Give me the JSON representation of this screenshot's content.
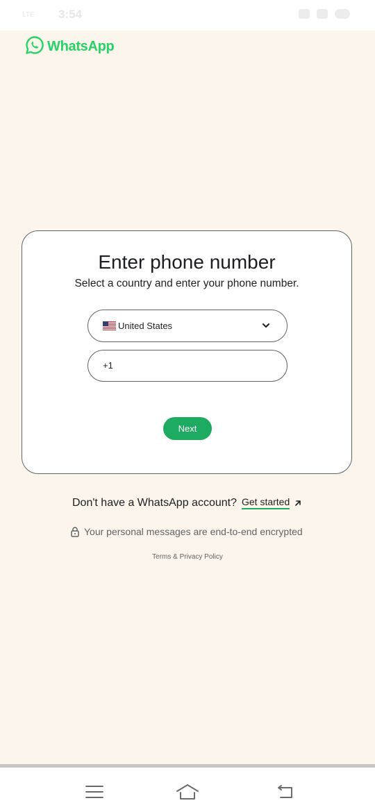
{
  "status_bar": {
    "time": "3:54",
    "signal": "LTE"
  },
  "brand": {
    "name": "WhatsApp",
    "color": "#25d366",
    "icon": "whatsapp-logo-icon"
  },
  "card": {
    "title": "Enter phone number",
    "subtitle": "Select a country and enter your phone number.",
    "country_select": {
      "selected": "United States",
      "flag": "us-flag-icon"
    },
    "phone_field": {
      "country_code": "+1"
    },
    "next_label": "Next"
  },
  "signup": {
    "prompt": "Don't have a WhatsApp account?",
    "link_label": "Get started"
  },
  "encryption": {
    "text": "Your personal messages are end-to-end encrypted",
    "icon": "lock-icon"
  },
  "terms": {
    "label": "Terms & Privacy Policy"
  },
  "nav_bar": {
    "icons": [
      "menu-icon",
      "home-icon",
      "back-icon"
    ]
  },
  "colors": {
    "background": "#fcf5eb",
    "accent": "#1daa61",
    "brand": "#25d366"
  }
}
